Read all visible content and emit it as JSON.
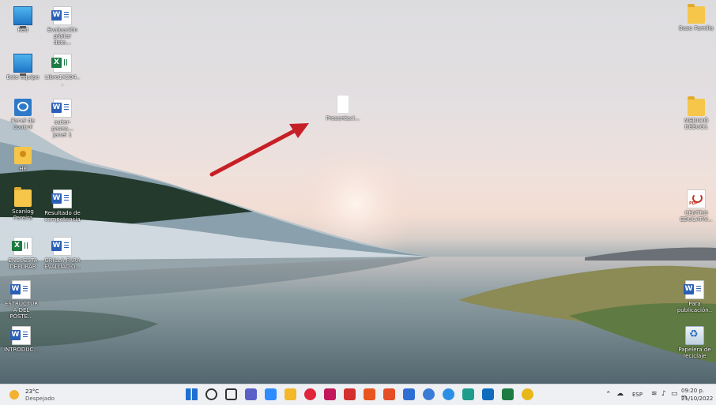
{
  "desktop": {
    "icons": [
      {
        "label": "Red"
      },
      {
        "label": "Evaluación póster dsto..."
      },
      {
        "label": "Base Familia"
      },
      {
        "label": "Este equipo"
      },
      {
        "label": "Libro1X204..."
      },
      {
        "label": "Panel de control"
      },
      {
        "label": "autor-pasea... janel 1"
      },
      {
        "label": "Presentaci..."
      },
      {
        "label": "MEDICIÓ DEBUG1"
      },
      {
        "label": "HP"
      },
      {
        "label": "Scanlog Pereira"
      },
      {
        "label": "Resultado de competencia"
      },
      {
        "label": "CENTRO EDUCATIV..."
      },
      {
        "label": "ENCUESTA DEPURAR"
      },
      {
        "label": "GRILLA PARA EVALUACIÓ..."
      },
      {
        "label": "ESTRUCTURA DEL PÓSTE..."
      },
      {
        "label": "Para publicación..."
      },
      {
        "label": "INTRODUC..."
      },
      {
        "label": "Papelera de reciclaje"
      }
    ]
  },
  "taskbar": {
    "weather": {
      "temp": "23°C",
      "condition": "Despejado"
    },
    "apps": [
      {
        "name": "start-button",
        "color": "#1f6fd0"
      },
      {
        "name": "search-button",
        "color": "#333333"
      },
      {
        "name": "task-view-button",
        "color": "#333333"
      },
      {
        "name": "chat-app",
        "color": "#5b5fc7"
      },
      {
        "name": "zoom-app",
        "color": "#2d8cff"
      },
      {
        "name": "file-explorer-app",
        "color": "#f3b72a"
      },
      {
        "name": "opera-app",
        "color": "#e0243b"
      },
      {
        "name": "app-red",
        "color": "#c2185b"
      },
      {
        "name": "acrobat-app",
        "color": "#d32f2f"
      },
      {
        "name": "app-orange",
        "color": "#e8551f"
      },
      {
        "name": "app-pinwheel",
        "color": "#e44d26"
      },
      {
        "name": "app-grid",
        "color": "#2f6fd3"
      },
      {
        "name": "app-blue-circle",
        "color": "#3a7bd5"
      },
      {
        "name": "app-blue-circle-2",
        "color": "#2c8fe6"
      },
      {
        "name": "edge-app",
        "color": "#1e9c8c"
      },
      {
        "name": "outlook-app",
        "color": "#0f6cbd"
      },
      {
        "name": "excel-app",
        "color": "#1d7a43"
      },
      {
        "name": "chrome-app",
        "color": "#e8b71a"
      }
    ],
    "tray": {
      "language": "ESP",
      "time": "09:20 p. m.",
      "date": "21/10/2022"
    }
  }
}
